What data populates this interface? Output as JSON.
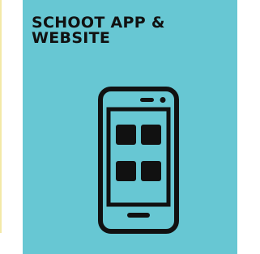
{
  "card": {
    "title": "SCHOOT APP & WEBSITE",
    "icon": "smartphone-apps-icon",
    "background_color": "#67c7d3",
    "text_color": "#111111"
  },
  "page": {
    "accent_color": "#f3e9a8"
  }
}
